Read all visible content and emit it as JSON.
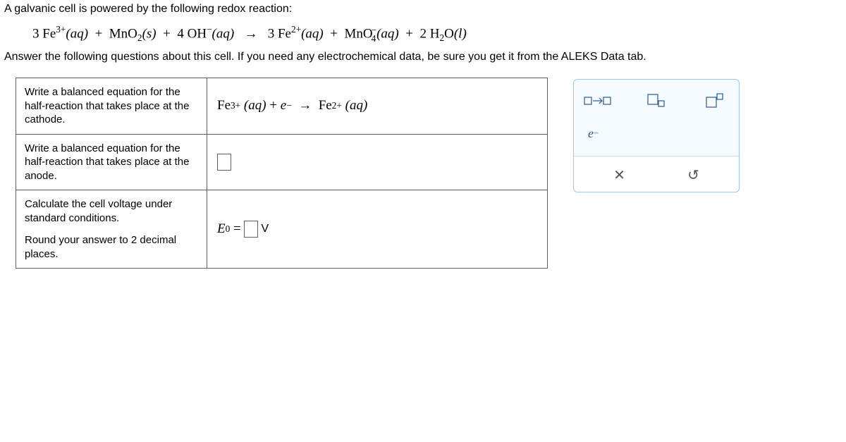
{
  "intro": "A galvanic cell is powered by the following redox reaction:",
  "equation": {
    "coef1": "3",
    "sp1": "Fe",
    "charge1": "3+",
    "phase1": "(aq)",
    "plus1": "+",
    "sp2": "MnO",
    "sub2": "2",
    "phase2": "(s)",
    "plus2": "+",
    "coef3": "4",
    "sp3": "OH",
    "charge3": "−",
    "phase3": "(aq)",
    "arrow": "→",
    "coef4": "3",
    "sp4": "Fe",
    "charge4": "2+",
    "phase4": "(aq)",
    "plus3": "+",
    "sp5": "MnO",
    "sub5a": "4",
    "charge5": "−",
    "phase5": "(aq)",
    "plus4": "+",
    "coef6": "2",
    "sp6": "H",
    "sub6": "2",
    "sp6b": "O",
    "phase6": "(l)"
  },
  "question": "Answer the following questions about this cell. If you need any electrochemical data, be sure you get it from the ALEKS Data tab.",
  "rows": {
    "cathode_label": "Write a balanced equation for the half-reaction that takes place at the cathode.",
    "anode_label": "Write a balanced equation for the half-reaction that takes place at the anode.",
    "voltage_label_a": "Calculate the cell voltage under standard conditions.",
    "voltage_label_b": "Round your answer to 2 decimal places."
  },
  "cathode_eq": {
    "sp1": "Fe",
    "ch1": "3+",
    "ph1": "(aq)",
    "plus": "+",
    "e": "e",
    "em": "−",
    "arrow": "→",
    "sp2": "Fe",
    "ch2": "2+",
    "ph2": "(aq)"
  },
  "E0": {
    "E": "E",
    "zero": "0",
    "eq": "=",
    "V": "V"
  },
  "palette": {
    "arrow": "→",
    "e": "e",
    "eminus": "−",
    "x": "✕",
    "undo": "↺"
  }
}
